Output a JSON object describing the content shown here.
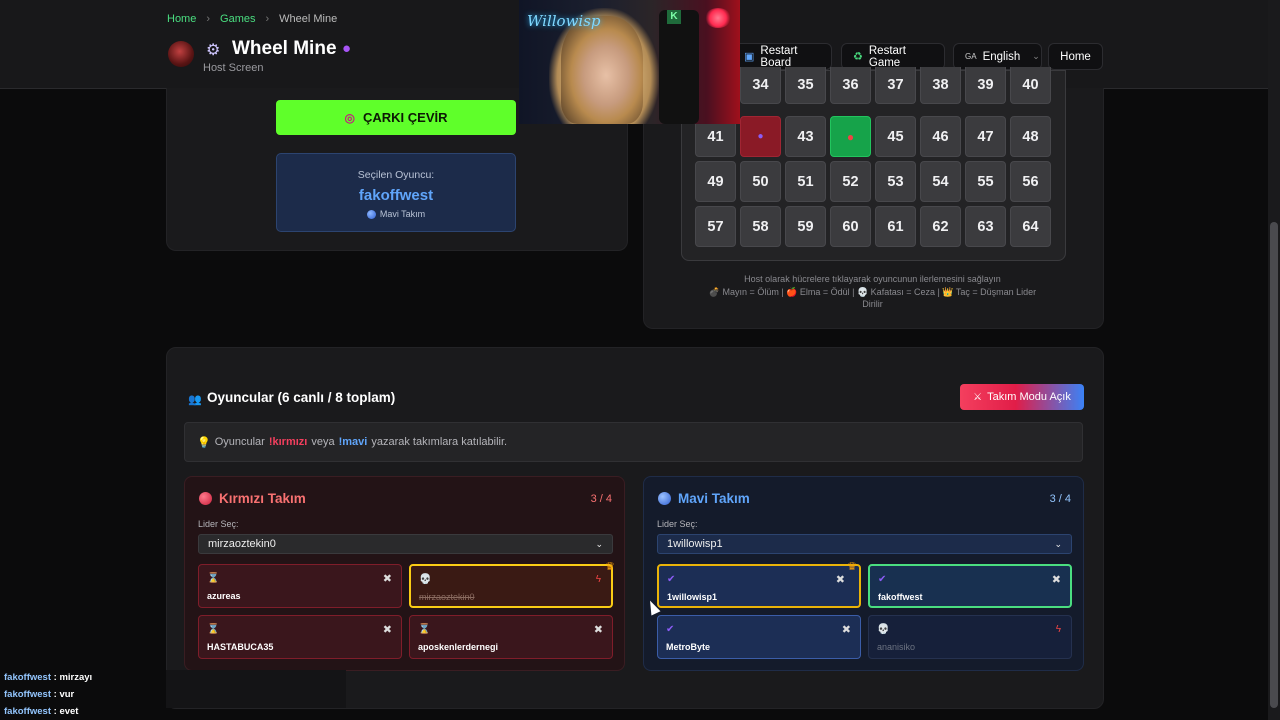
{
  "header": {
    "breadcrumbs": [
      "Home",
      "Games",
      "Wheel Mine"
    ],
    "title": "Wheel Mine",
    "subtitle": "Host Screen",
    "buttons": {
      "restart_board": "Restart Board",
      "restart_game": "Restart Game",
      "language": "English",
      "language_prefix": "GA",
      "home": "Home"
    }
  },
  "webcam": {
    "neon_text": "Willowisp"
  },
  "spin_button": {
    "label": "ÇARKI ÇEVİR"
  },
  "selected_player": {
    "label": "Seçilen Oyuncu:",
    "name": "fakoffwest",
    "team": "Mavi Takım"
  },
  "board": {
    "rows": [
      [
        "34",
        "35",
        "36",
        "37",
        "38",
        "39",
        "40"
      ],
      [
        "41",
        "",
        "43",
        "",
        "45",
        "46",
        "47",
        "48"
      ],
      [
        "49",
        "50",
        "51",
        "52",
        "53",
        "54",
        "55",
        "56"
      ],
      [
        "57",
        "58",
        "59",
        "60",
        "61",
        "62",
        "63",
        "64"
      ]
    ],
    "special_cells": {
      "42": "mine",
      "44": "apple"
    },
    "host_note": "Host olarak hücrelere tıklayarak oyuncunun ilerlemesini sağlayın",
    "legend": "💣 Mayın = Ölüm | 🍎 Elma = Ödül | 💀 Kafatası = Ceza | 👑 Taç = Düşman Lider",
    "legend_cont": "Dirilir"
  },
  "players": {
    "title": "Oyuncular (6 canlı / 8 toplam)",
    "team_mode_button": "Takım Modu Açık",
    "info_prefix": "Oyuncular",
    "info_red_cmd": "!kırmızı",
    "info_mid": "veya",
    "info_blue_cmd": "!mavi",
    "info_suffix": "yazarak takımlara katılabilir."
  },
  "teams": {
    "red": {
      "name": "Kırmızı Takım",
      "count": "3 / 4",
      "leader_label": "Lider Seç:",
      "leader": "mirzaoztekin0",
      "players": [
        "azureas",
        "mirzaoztekin0",
        "HASTABUCA35",
        "aposkenlerdernegi"
      ]
    },
    "blue": {
      "name": "Mavi Takım",
      "count": "3 / 4",
      "leader_label": "Lider Seç:",
      "leader": "1willowisp1",
      "players": [
        "1willowisp1",
        "fakoffwest",
        "MetroByte",
        "ananisiko"
      ]
    }
  },
  "chat": [
    {
      "user": "fakoffwest",
      "msg": "mirzayı"
    },
    {
      "user": "fakoffwest",
      "msg": "vur"
    },
    {
      "user": "fakoffwest",
      "msg": "evet"
    }
  ],
  "colors": {
    "accent_green": "#4ade80",
    "spin_green": "#5fff2a",
    "red_team": "#f43f5e",
    "blue_team": "#60a5fa"
  }
}
